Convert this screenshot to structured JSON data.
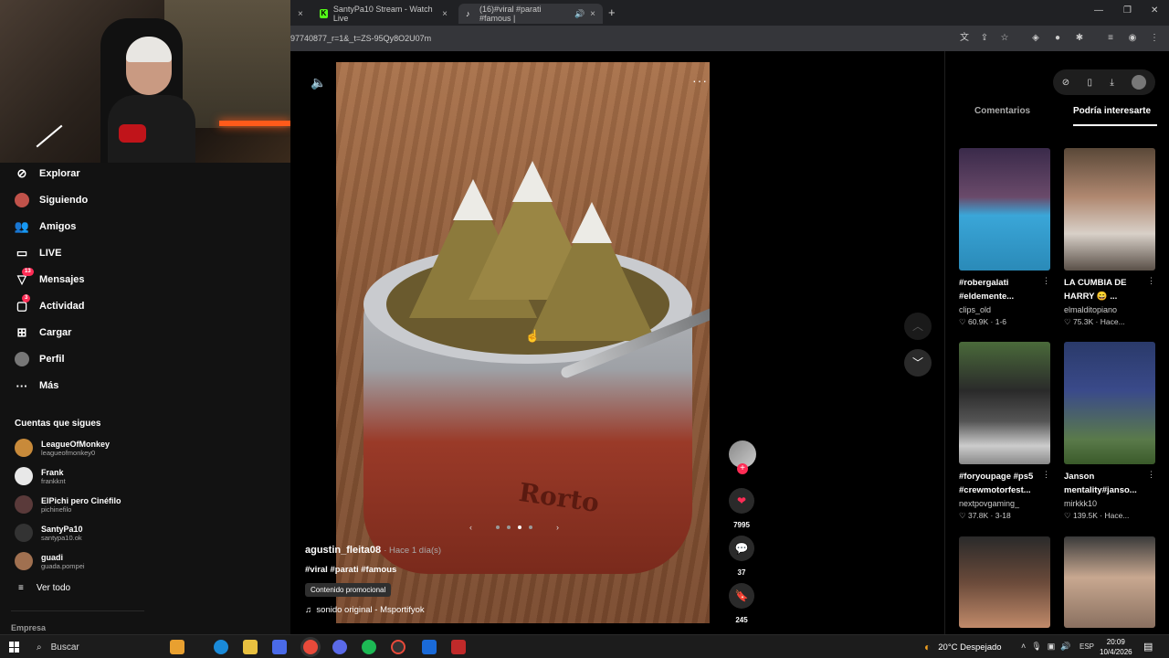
{
  "browser": {
    "tabs": [
      {
        "title": "",
        "close": "×"
      },
      {
        "title": "SantyPa10 Stream - Watch Live",
        "close": "×"
      },
      {
        "title": "(16)#viral #parati #famous |",
        "close": "×"
      }
    ],
    "new_tab": "+",
    "url": "97740877_r=1&_t=ZS-95Qy8O2U07m"
  },
  "sidebar": {
    "nav": [
      {
        "label": "Explorar",
        "icon": "compass-icon"
      },
      {
        "label": "Siguiendo",
        "icon": "following-avatar-icon"
      },
      {
        "label": "Amigos",
        "icon": "friends-icon"
      },
      {
        "label": "LIVE",
        "icon": "live-tv-icon"
      },
      {
        "label": "Mensajes",
        "icon": "message-icon",
        "badge": "13"
      },
      {
        "label": "Actividad",
        "icon": "activity-icon",
        "badge": "3"
      },
      {
        "label": "Cargar",
        "icon": "upload-icon"
      },
      {
        "label": "Perfil",
        "icon": "profile-avatar-icon"
      },
      {
        "label": "Más",
        "icon": "more-dots-icon"
      }
    ],
    "following_title": "Cuentas que sigues",
    "accounts": [
      {
        "name": "LeagueOfMonkey",
        "handle": "leagueofmonkey0"
      },
      {
        "name": "Frank",
        "handle": "frankknt"
      },
      {
        "name": "ElPichi pero Cinéfilo",
        "handle": "pichinefilo"
      },
      {
        "name": "SantyPa10",
        "handle": "santypa10.ok"
      },
      {
        "name": "guadi",
        "handle": "guada.pompei"
      }
    ],
    "see_all": "Ver todo",
    "company": "Empresa"
  },
  "video": {
    "author": "agustin_fleita08",
    "ago": "· Hace 1 día(s)",
    "caption": "#viral #parati #famous",
    "promo": "Contenido promocional",
    "sound": "sonido original - Msportifyok",
    "cup_text": "Rorto",
    "carousel_prev": "‹",
    "carousel_next": "›",
    "likes": "7995",
    "comments": "37",
    "saves": "245"
  },
  "right_panel": {
    "tab_comments": "Comentarios",
    "tab_suggested": "Podría interesarte",
    "cards": [
      {
        "title": "#robergalati",
        "title2": "#eldemente...",
        "author": "clips_old",
        "stats": "♡ 60.9K · 1-6"
      },
      {
        "title": "LA CUMBIA DE",
        "title2": "HARRY 😄 ...",
        "author": "elmalditopiano",
        "stats": "♡ 75.3K · Hace..."
      },
      {
        "title": "#foryoupage #ps5",
        "title2": "#crewmotorfest...",
        "author": "nextpovgaming_",
        "stats": "♡ 37.8K · 3-18"
      },
      {
        "title": "Janson",
        "title2": "mentality#janso...",
        "author": "mirkkk10",
        "stats": "♡ 139.5K · Hace..."
      },
      {
        "title": "",
        "title2": "",
        "author": "",
        "stats": ""
      },
      {
        "title": "",
        "title2": "",
        "author": "",
        "stats": ""
      }
    ]
  },
  "taskbar": {
    "search": "Buscar",
    "weather": "20°C  Despejado",
    "lang": "ESP",
    "time": "20:09",
    "date": "10/4/2026"
  }
}
